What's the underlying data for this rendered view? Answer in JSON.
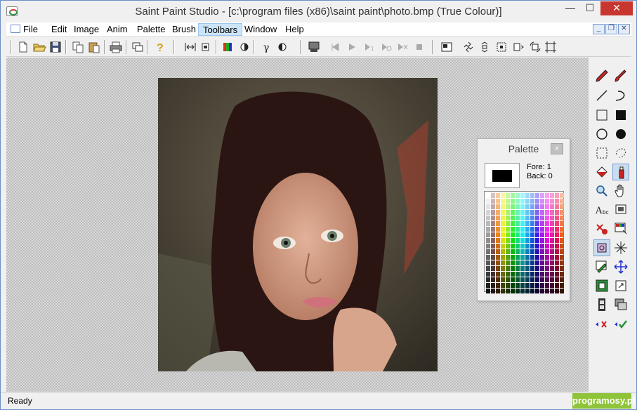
{
  "window": {
    "title": "Saint Paint Studio - [c:\\program files (x86)\\saint paint\\photo.bmp (True Colour)]",
    "minimize_glyph": "—",
    "maximize_glyph": "☐",
    "close_glyph": "✕"
  },
  "menu": {
    "items": [
      "File",
      "Edit",
      "Image",
      "Anim",
      "Palette",
      "Brush",
      "Toolbars",
      "Window",
      "Help"
    ],
    "active": "Toolbars",
    "mdi_buttons": [
      "_",
      "❐",
      "✕"
    ]
  },
  "toolbar": {
    "icons": [
      "new-icon",
      "open-icon",
      "save-icon",
      "copy-icon",
      "paste-icon",
      "print-icon",
      "window-icon",
      "help-icon",
      "resize-icon",
      "crop-icon",
      "color-balance-icon",
      "brightness-icon",
      "gamma-icon",
      "contrast-icon",
      "animation-icon",
      "first-frame-icon",
      "play-icon",
      "next-frame-icon",
      "loop-icon",
      "shuffle-icon",
      "stop-icon",
      "view-icon",
      "rotate-left-icon",
      "rotate-right-icon",
      "select-icon",
      "flip-icon",
      "rotate-icon",
      "resize-canvas-icon"
    ]
  },
  "palette": {
    "title": "Palette",
    "close": "x",
    "fore_label": "Fore: 1",
    "back_label": "Back: 0",
    "fore_color": "#000000"
  },
  "status": {
    "text": "Ready",
    "watermark": "programosy.pl"
  },
  "colors": {
    "accent": "#c7372f",
    "menu_highlight": "#cce4f7",
    "watermark_bg": "#8fc43a"
  }
}
